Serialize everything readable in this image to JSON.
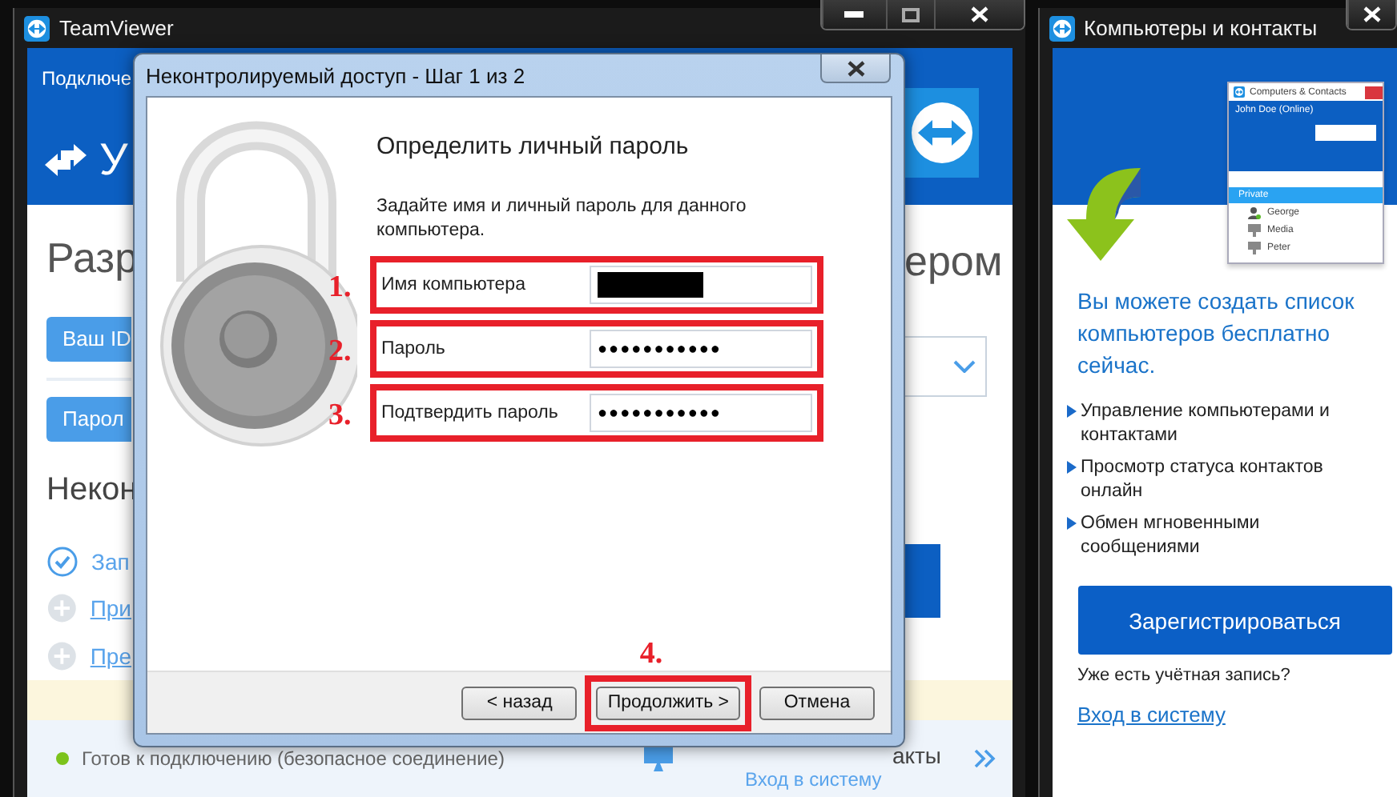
{
  "main_window": {
    "title": "TeamViewer",
    "header_tab": "Подключе",
    "header_heading": "У",
    "heading": "Разр",
    "heading_right": "ером",
    "id_button": "Ваш ID",
    "password_button": "Парол",
    "section": "Некон",
    "steps": [
      {
        "label": "Зап",
        "done": true
      },
      {
        "label": "При",
        "done": false
      },
      {
        "label": "Пре",
        "done": false
      }
    ],
    "status": "Готов к подключению (безопасное соединение)",
    "contacts_label": "акты",
    "login_link": "Вход в систему"
  },
  "dialog": {
    "title": "Неконтролируемый доступ - Шаг 1 из 2",
    "heading": "Определить личный пароль",
    "description": "Задайте имя и личный пароль для данного компьютера.",
    "fields": [
      {
        "marker": "1.",
        "label": "Имя компьютера",
        "kind": "redacted"
      },
      {
        "marker": "2.",
        "label": "Пароль",
        "kind": "password",
        "value": "●●●●●●●●●●●"
      },
      {
        "marker": "3.",
        "label": "Подтвердить пароль",
        "kind": "password",
        "value": "●●●●●●●●●●●"
      }
    ],
    "buttons": [
      {
        "label": "< назад",
        "highlighted": false
      },
      {
        "label": "Продолжить >",
        "highlighted": true,
        "marker": "4."
      },
      {
        "label": "Отмена",
        "highlighted": false
      }
    ]
  },
  "contacts_window": {
    "title": "Компьютеры и контакты",
    "preview": {
      "title": "Computers & Contacts",
      "user": "John Doe (Online)",
      "group": "Private",
      "contacts": [
        {
          "name": "George",
          "kind": "person"
        },
        {
          "name": "Media",
          "kind": "computer"
        },
        {
          "name": "Peter",
          "kind": "computer"
        }
      ]
    },
    "promo": "Вы можете создать список компьютеров бесплатно сейчас.",
    "features": [
      "Управление компьютерами и контактами",
      "Просмотр статуса контактов онлайн",
      "Обмен мгновенными сообщениями"
    ],
    "register_button": "Зарегистрироваться",
    "account_question": "Уже есть учётная запись?",
    "login_link": "Вход в систему"
  }
}
